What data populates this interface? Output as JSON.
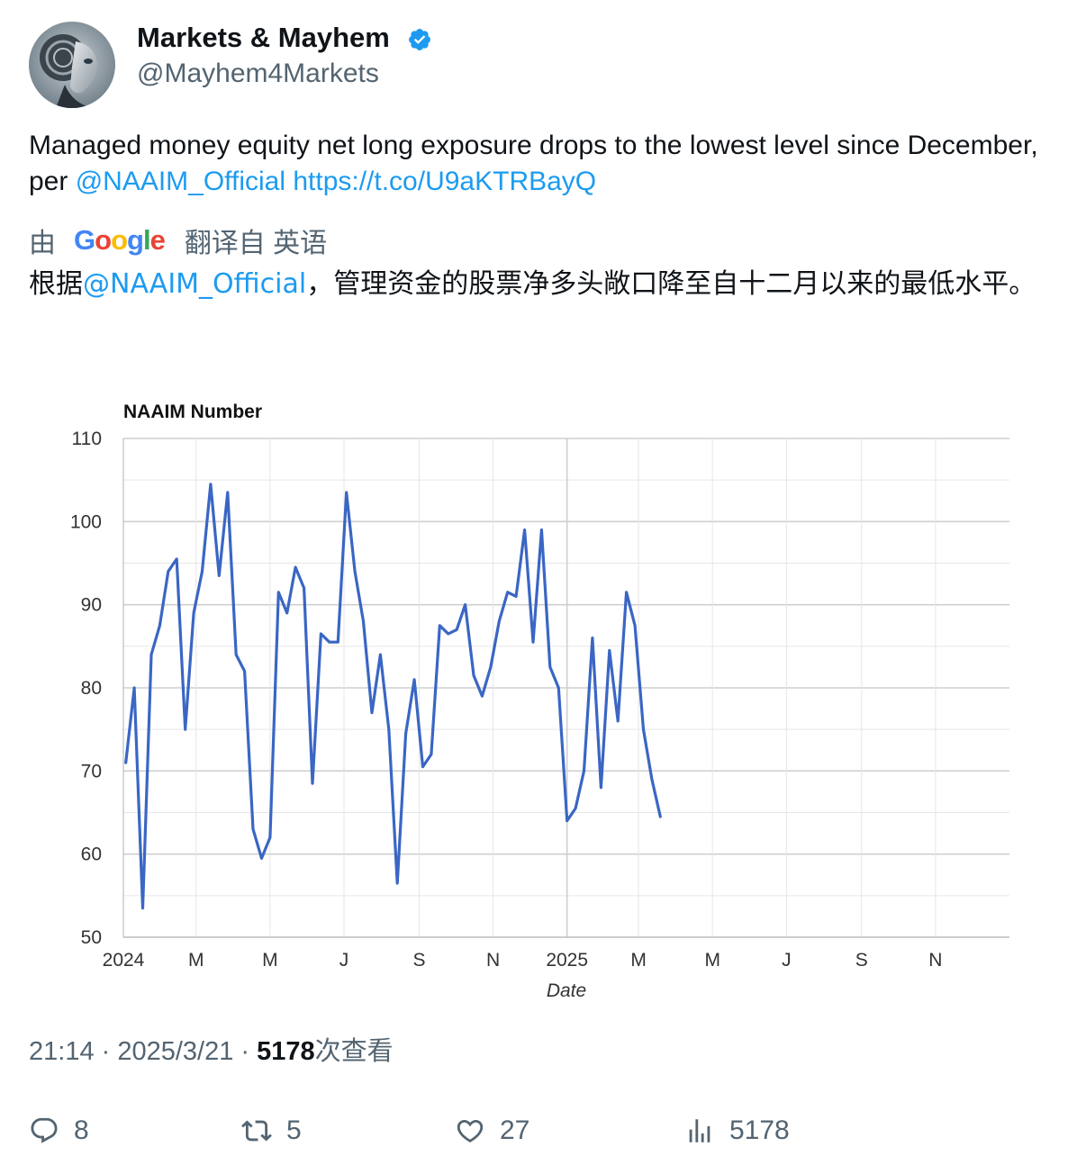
{
  "author": {
    "display_name": "Markets & Mayhem",
    "handle": "@Mayhem4Markets",
    "verified": true
  },
  "tweet": {
    "text_before": "Managed money equity net long exposure drops to the lowest level since December, per ",
    "mention": "@NAAIM_Official",
    "link": "https://t.co/U9aKTRBayQ"
  },
  "translation": {
    "by": "由",
    "google_letters": [
      "G",
      "o",
      "o",
      "g",
      "l",
      "e"
    ],
    "google_colors": [
      "#4285F4",
      "#EA4335",
      "#FBBC05",
      "#4285F4",
      "#34A853",
      "#EA4335"
    ],
    "from": "翻译自 英语",
    "text_before": "根据",
    "mention": "@NAAIM_Official",
    "text_after": "，管理资金的股票净多头敞口降至自十二月以来的最低水平。"
  },
  "chart_data": {
    "type": "line",
    "title": "NAAIM Number",
    "xlabel": "Date",
    "ylabel": "",
    "ylim": [
      50,
      110
    ],
    "yticks": [
      50,
      60,
      70,
      80,
      90,
      100,
      110
    ],
    "grid": true,
    "x_tick_labels": [
      "2024",
      "M",
      "M",
      "J",
      "S",
      "N",
      "2025",
      "M",
      "M",
      "J",
      "S",
      "N"
    ],
    "series": [
      {
        "color": "#3a66c4",
        "x": [
          "2024-01-03",
          "2024-01-10",
          "2024-01-17",
          "2024-01-24",
          "2024-01-31",
          "2024-02-07",
          "2024-02-14",
          "2024-02-21",
          "2024-02-28",
          "2024-03-06",
          "2024-03-13",
          "2024-03-20",
          "2024-03-27",
          "2024-04-03",
          "2024-04-10",
          "2024-04-17",
          "2024-04-24",
          "2024-05-01",
          "2024-05-08",
          "2024-05-15",
          "2024-05-22",
          "2024-05-29",
          "2024-06-05",
          "2024-06-12",
          "2024-06-19",
          "2024-06-26",
          "2024-07-03",
          "2024-07-10",
          "2024-07-17",
          "2024-07-24",
          "2024-07-31",
          "2024-08-07",
          "2024-08-14",
          "2024-08-21",
          "2024-08-28",
          "2024-09-04",
          "2024-09-11",
          "2024-09-18",
          "2024-09-25",
          "2024-10-02",
          "2024-10-09",
          "2024-10-16",
          "2024-10-23",
          "2024-10-30",
          "2024-11-06",
          "2024-11-13",
          "2024-11-20",
          "2024-11-27",
          "2024-12-04",
          "2024-12-11",
          "2024-12-18",
          "2024-12-25",
          "2025-01-01",
          "2025-01-08",
          "2025-01-15",
          "2025-01-22",
          "2025-01-29",
          "2025-02-05",
          "2025-02-12",
          "2025-02-19",
          "2025-02-26",
          "2025-03-05",
          "2025-03-12",
          "2025-03-19"
        ],
        "y": [
          71,
          80,
          53.5,
          84,
          87.5,
          94,
          95.5,
          75,
          89,
          94,
          104.5,
          93.5,
          103.5,
          84,
          82,
          63,
          59.5,
          62,
          91.5,
          89,
          94.5,
          92,
          68.5,
          86.5,
          85.5,
          85.5,
          103.5,
          94,
          88,
          77,
          84,
          75,
          56.5,
          74.5,
          81,
          70.5,
          72,
          87.5,
          86.5,
          87,
          90,
          81.5,
          79,
          82.5,
          88,
          91.5,
          91,
          99,
          85.5,
          99,
          82.5,
          80,
          64,
          65.5,
          70,
          86,
          68,
          84.5,
          76,
          91.5,
          87.5,
          75,
          69,
          64.5
        ]
      }
    ]
  },
  "meta": {
    "time": "21:14 · 2025/3/21 · ",
    "views_count": "5178",
    "views_label": "次查看"
  },
  "actions": {
    "replies": "8",
    "retweets": "5",
    "likes": "27",
    "views": "5178"
  }
}
